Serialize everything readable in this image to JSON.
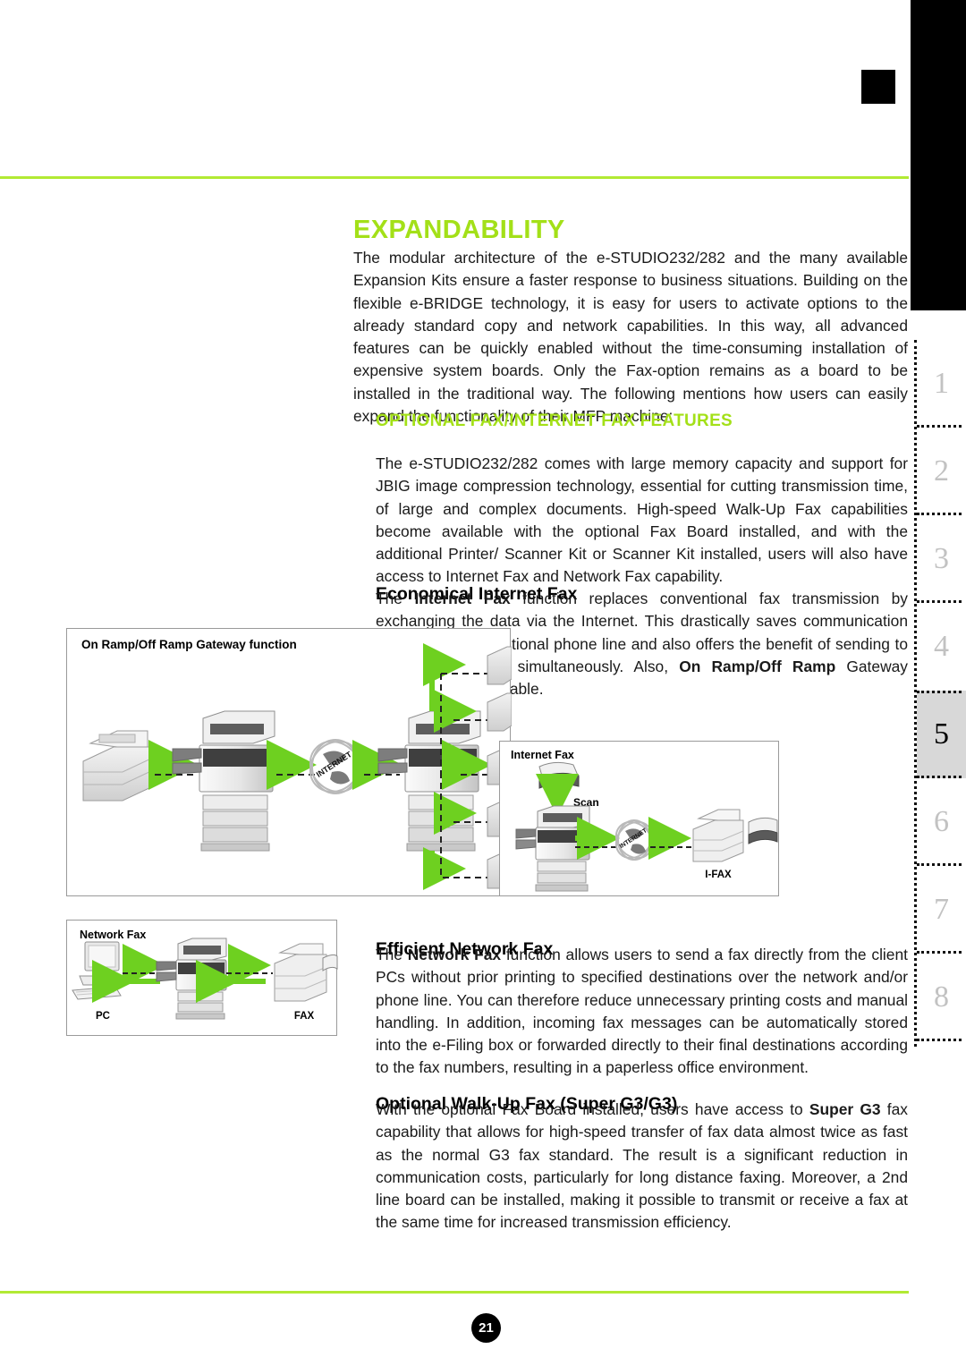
{
  "page": {
    "title": "EXPANDABILITY",
    "number": "21",
    "accent_green": "#a3e018",
    "rule_green": "#b2ea34",
    "arrow_green": "#6ed020",
    "active_tab_bg": "#d8d8d8"
  },
  "intro": "The modular architecture of the e-STUDIO232/282 and the many available Expansion Kits ensure a faster response to business situations. Building on the flexible e-BRIDGE technology, it is easy for users to activate options to the already standard copy and network capabilities. In this way, all advanced features can be quickly enabled without the time-consuming installation of expensive system boards. Only the Fax-option remains as a board to be installed in the traditional way. The following mentions how users can easily expand the functionality of their MFP machine:",
  "sections": [
    {
      "heading": "OPTIONAL FAX/INTERNET FAX FEATURES",
      "body": "The e-STUDIO232/282 comes with large memory capacity and support for JBIG image compression technology, essential for cutting transmission time, of large and complex documents. High-speed Walk-Up Fax capabilities become available with the optional Fax Board installed, and with the additional Printer/ Scanner Kit or Scanner Kit installed, users will also have access to Internet Fax and Network Fax capability."
    }
  ],
  "subsections": [
    {
      "heading": "Economical Internet Fax",
      "body_part1": "The ",
      "bold1": "Internet Fax",
      "body_part2": " function replaces conventional fax transmission by exchanging the data via the Internet. This drastically saves communication costs of the conventional phone line and also offers the benefit of sending to multiple recipients simultaneously. Also, ",
      "bold2": "On Ramp/Off Ramp",
      "body_part3": " Gateway functionality is available."
    },
    {
      "heading": "Efficient Network Fax",
      "body_part1": "The ",
      "bold1": "Network Fax",
      "body_part2": " function allows users to send a fax directly from the client PCs without prior printing to specified destinations over the network and/or phone line. You can therefore reduce unnecessary printing costs and manual handling. In addition, incoming fax messages can be automatically stored into the e-Filing box or forwarded directly to their final destinations according to the fax numbers, resulting in a paperless office environment."
    },
    {
      "heading": "Optional Walk-Up Fax (Super G3/G3)",
      "body_part1": "With the optional Fax Board installed, users have access to ",
      "bold1": "Super G3",
      "body_part2": " fax capability that allows for high-speed transfer of fax data almost twice as fast as the normal G3 fax standard. The result is a significant reduction in communication costs, particularly for long distance faxing. Moreover, a 2nd line board can be installed, making it possible to transmit or receive a fax at the same time for increased transmission efficiency."
    }
  ],
  "diagrams": {
    "gateway": {
      "title": "On Ramp/Off Ramp Gateway function",
      "internet_label": "INTERNET",
      "receiver_count": 5
    },
    "internet_fax": {
      "title": "Internet Fax",
      "scan_label": "Scan",
      "ifax_label": "I-FAX",
      "internet_label": "INTERNET"
    },
    "network_fax": {
      "title": "Network Fax",
      "pc_label": "PC",
      "fax_label": "FAX"
    }
  },
  "tabs": [
    {
      "label": "1",
      "active": false
    },
    {
      "label": "2",
      "active": false
    },
    {
      "label": "3",
      "active": false
    },
    {
      "label": "4",
      "active": false
    },
    {
      "label": "5",
      "active": true
    },
    {
      "label": "6",
      "active": false
    },
    {
      "label": "7",
      "active": false
    },
    {
      "label": "8",
      "active": false
    }
  ]
}
